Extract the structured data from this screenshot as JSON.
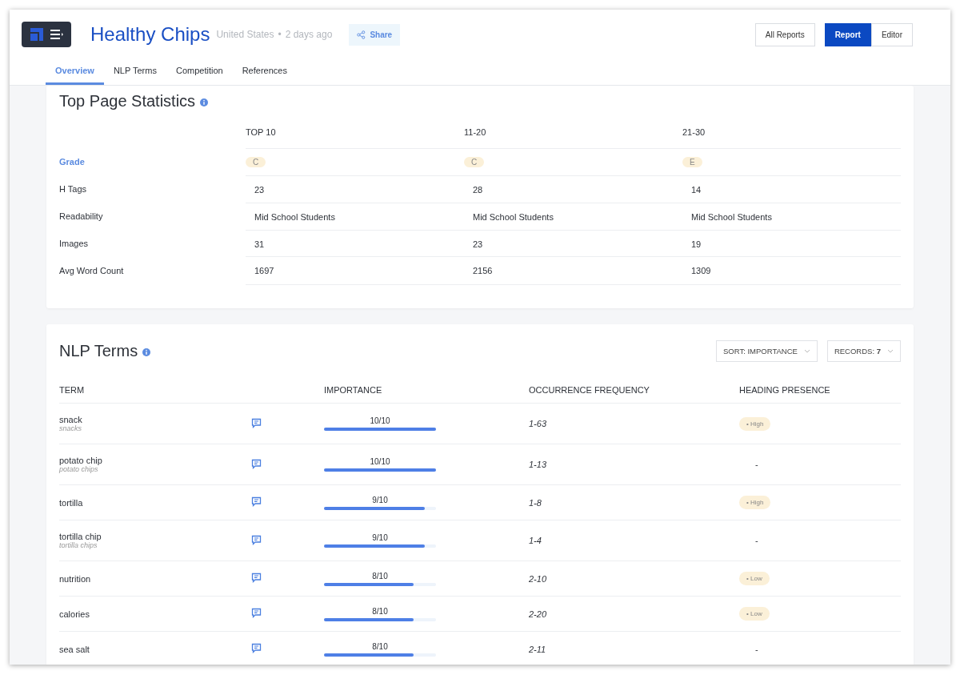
{
  "header": {
    "title": "Healthy Chips",
    "location": "United States",
    "separator": "•",
    "age": "2 days ago",
    "share": "Share",
    "all_reports": "All Reports",
    "view_toggle": [
      {
        "label": "Report",
        "selected": true
      },
      {
        "label": "Editor",
        "selected": false
      }
    ]
  },
  "tabs": [
    {
      "label": "Overview",
      "selected": true
    },
    {
      "label": "NLP Terms",
      "selected": false
    },
    {
      "label": "Competition",
      "selected": false
    },
    {
      "label": "References",
      "selected": false
    }
  ],
  "stats": {
    "title": "Top Page Statistics",
    "columns": [
      "TOP 10",
      "11-20",
      "21-30"
    ],
    "rows": [
      {
        "label": "Grade",
        "kind": "grade",
        "values": [
          "C",
          "C",
          "E"
        ]
      },
      {
        "label": "H Tags",
        "kind": "text",
        "values": [
          "23",
          "28",
          "14"
        ]
      },
      {
        "label": "Readability",
        "kind": "text",
        "values": [
          "Mid School Students",
          "Mid School Students",
          "Mid School Students"
        ]
      },
      {
        "label": "Images",
        "kind": "text",
        "values": [
          "31",
          "23",
          "19"
        ]
      },
      {
        "label": "Avg Word Count",
        "kind": "text",
        "values": [
          "1697",
          "2156",
          "1309"
        ]
      }
    ]
  },
  "nlp": {
    "title": "NLP Terms",
    "sort": "SORT: IMPORTANCE",
    "records_label": "RECORDS:",
    "records_value": "7",
    "columns": [
      "TERM",
      "IMPORTANCE",
      "OCCURRENCE FREQUENCY",
      "HEADING PRESENCE"
    ],
    "rows": [
      {
        "term": "snack",
        "variant": "snacks",
        "score": "10/10",
        "level": 1.0,
        "frequency": "1-63",
        "heading": {
          "kind": "badge",
          "text": "• High"
        }
      },
      {
        "term": "potato chip",
        "variant": "potato chips",
        "score": "10/10",
        "level": 1.0,
        "frequency": "1-13",
        "heading": {
          "kind": "dash",
          "text": "-"
        }
      },
      {
        "term": "tortilla",
        "score": "9/10",
        "level": 0.9,
        "frequency": "1-8",
        "heading": {
          "kind": "badge",
          "text": "• High"
        }
      },
      {
        "term": "tortilla chip",
        "variant": "tortilla chips",
        "score": "9/10",
        "level": 0.9,
        "frequency": "1-4",
        "heading": {
          "kind": "dash",
          "text": "-"
        }
      },
      {
        "term": "nutrition",
        "score": "8/10",
        "level": 0.8,
        "frequency": "2-10",
        "heading": {
          "kind": "badge",
          "text": "• Low"
        }
      },
      {
        "term": "calories",
        "score": "8/10",
        "level": 0.8,
        "frequency": "2-20",
        "heading": {
          "kind": "badge",
          "text": "• Low"
        }
      },
      {
        "term": "sea salt",
        "score": "8/10",
        "level": 0.8,
        "frequency": "2-11",
        "heading": {
          "kind": "dash",
          "text": "-"
        }
      }
    ]
  }
}
